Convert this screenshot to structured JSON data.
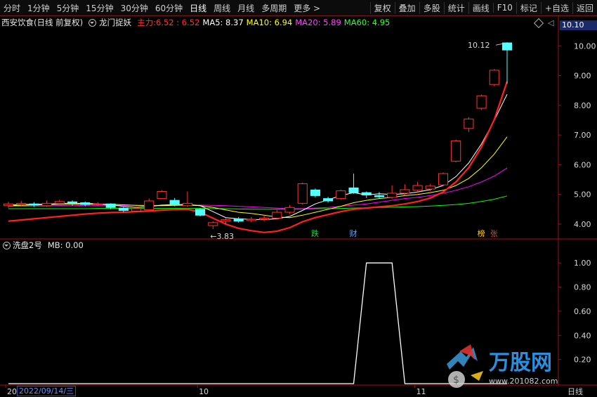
{
  "toolbar": {
    "left_items": [
      "分时",
      "1分钟",
      "5分钟",
      "15分钟",
      "30分钟",
      "60分钟",
      "日线",
      "周线",
      "月线",
      "多周期",
      "更多 >"
    ],
    "active": "日线",
    "right_items": [
      "复权",
      "叠加",
      "多股",
      "统计",
      "画线",
      "F10",
      "标记",
      "+自选",
      "返回"
    ]
  },
  "info": {
    "stock": "西安饮食(日线 前复权)",
    "indicator": "龙门捉妖",
    "main_label": "主力:",
    "main_value": "6.52 : 6.52",
    "ma5": "MA5: 8.37",
    "ma10": "MA10: 6.94",
    "ma20": "MA20: 5.89",
    "ma60": "MA60: 4.95",
    "current_price": "10.10"
  },
  "indicator_panel": {
    "name": "洗盘2号",
    "value": "MB: 0.00"
  },
  "colors": {
    "up": "#ff3232",
    "down": "#54ffff",
    "ma5": "#ffffff",
    "ma10": "#ffff00",
    "ma20": "#ff00ff",
    "ma60": "#00ff00",
    "main": "#ff2020",
    "axis": "#a01010"
  },
  "chart_data": [
    {
      "type": "candlestick",
      "yaxis_ticks": [
        "10.00",
        "9.00",
        "8.00",
        "7.00",
        "6.00",
        "5.00",
        "4.00"
      ],
      "ylim": [
        3.55,
        10.55
      ],
      "annotations": {
        "high_label": "10.12",
        "low_label": "←3.83",
        "low_value": 3.83
      },
      "markers": [
        {
          "text": "跌",
          "color": "#22cc44",
          "index": 24
        },
        {
          "text": "财",
          "color": "#5fa8ff",
          "index": 27
        },
        {
          "text": "榜",
          "color": "#ffcc00",
          "index": 37
        },
        {
          "text": "张",
          "color": "#ff3333",
          "index": 38
        }
      ],
      "x_tick_labels": [
        {
          "text": "20",
          "index": 0
        },
        {
          "text": "10",
          "index": 15
        },
        {
          "text": "11",
          "index": 32
        }
      ],
      "x_selected_date": "2022/09/14/三",
      "candles": [
        {
          "o": 4.62,
          "c": 4.68,
          "h": 4.75,
          "l": 4.55
        },
        {
          "o": 4.66,
          "c": 4.7,
          "h": 4.78,
          "l": 4.6
        },
        {
          "o": 4.68,
          "c": 4.64,
          "h": 4.74,
          "l": 4.58
        },
        {
          "o": 4.62,
          "c": 4.7,
          "h": 4.8,
          "l": 4.58
        },
        {
          "o": 4.7,
          "c": 4.76,
          "h": 4.82,
          "l": 4.64
        },
        {
          "o": 4.75,
          "c": 4.7,
          "h": 4.8,
          "l": 4.62
        },
        {
          "o": 4.72,
          "c": 4.66,
          "h": 4.76,
          "l": 4.6
        },
        {
          "o": 4.66,
          "c": 4.68,
          "h": 4.74,
          "l": 4.6
        },
        {
          "o": 4.68,
          "c": 4.56,
          "h": 4.7,
          "l": 4.5
        },
        {
          "o": 4.54,
          "c": 4.46,
          "h": 4.58,
          "l": 4.4
        },
        {
          "o": 4.44,
          "c": 4.52,
          "h": 4.6,
          "l": 4.4
        },
        {
          "o": 4.48,
          "c": 4.78,
          "h": 4.86,
          "l": 4.44
        },
        {
          "o": 4.86,
          "c": 5.1,
          "h": 5.14,
          "l": 4.84
        },
        {
          "o": 4.8,
          "c": 4.66,
          "h": 4.88,
          "l": 4.6
        },
        {
          "o": 4.62,
          "c": 4.7,
          "h": 5.1,
          "l": 4.58
        },
        {
          "o": 4.5,
          "c": 4.3,
          "h": 4.54,
          "l": 4.26
        },
        {
          "o": 3.95,
          "c": 4.05,
          "h": 4.1,
          "l": 3.83
        },
        {
          "o": 4.1,
          "c": 4.15,
          "h": 4.2,
          "l": 4.0
        },
        {
          "o": 4.18,
          "c": 4.1,
          "h": 4.24,
          "l": 4.05
        },
        {
          "o": 4.12,
          "c": 4.16,
          "h": 4.24,
          "l": 4.06
        },
        {
          "o": 4.16,
          "c": 4.2,
          "h": 4.3,
          "l": 4.1
        },
        {
          "o": 4.2,
          "c": 4.4,
          "h": 4.48,
          "l": 4.16
        },
        {
          "o": 4.4,
          "c": 4.56,
          "h": 4.64,
          "l": 4.34
        },
        {
          "o": 4.7,
          "c": 5.36,
          "h": 5.4,
          "l": 4.66
        },
        {
          "o": 5.15,
          "c": 4.96,
          "h": 5.2,
          "l": 4.9
        },
        {
          "o": 4.86,
          "c": 4.78,
          "h": 4.92,
          "l": 4.72
        },
        {
          "o": 4.86,
          "c": 5.12,
          "h": 5.16,
          "l": 4.82
        },
        {
          "o": 5.22,
          "c": 5.06,
          "h": 5.7,
          "l": 5.02
        },
        {
          "o": 5.06,
          "c": 4.98,
          "h": 5.1,
          "l": 4.88
        },
        {
          "o": 4.96,
          "c": 4.92,
          "h": 5.08,
          "l": 4.86
        },
        {
          "o": 4.9,
          "c": 5.04,
          "h": 5.3,
          "l": 4.86
        },
        {
          "o": 5.04,
          "c": 5.16,
          "h": 5.34,
          "l": 4.96
        },
        {
          "o": 5.14,
          "c": 5.3,
          "h": 5.42,
          "l": 5.08
        },
        {
          "o": 5.18,
          "c": 5.28,
          "h": 5.36,
          "l": 5.1
        },
        {
          "o": 5.32,
          "c": 5.7,
          "h": 5.74,
          "l": 5.28
        },
        {
          "o": 6.12,
          "c": 6.8,
          "h": 6.84,
          "l": 6.08
        },
        {
          "o": 7.22,
          "c": 7.54,
          "h": 7.6,
          "l": 7.1
        },
        {
          "o": 7.9,
          "c": 8.32,
          "h": 8.36,
          "l": 7.84
        },
        {
          "o": 8.7,
          "c": 9.18,
          "h": 9.22,
          "l": 8.64
        },
        {
          "o": 10.1,
          "c": 9.86,
          "h": 10.12,
          "l": 8.72
        }
      ],
      "lines": {
        "ma5": [
          4.64,
          4.66,
          4.67,
          4.67,
          4.7,
          4.7,
          4.7,
          4.68,
          4.65,
          4.6,
          4.56,
          4.59,
          4.64,
          4.66,
          4.66,
          4.62,
          4.42,
          4.22,
          4.18,
          4.16,
          4.15,
          4.18,
          4.26,
          4.46,
          4.68,
          4.82,
          4.96,
          5.06,
          4.98,
          5.02,
          5.0,
          5.02,
          5.08,
          5.16,
          5.3,
          5.6,
          6.06,
          6.7,
          7.5,
          8.37
        ],
        "ma10": [
          4.62,
          4.63,
          4.64,
          4.65,
          4.66,
          4.67,
          4.67,
          4.67,
          4.67,
          4.65,
          4.63,
          4.62,
          4.62,
          4.63,
          4.64,
          4.62,
          4.56,
          4.48,
          4.4,
          4.36,
          4.3,
          4.24,
          4.22,
          4.3,
          4.4,
          4.5,
          4.6,
          4.72,
          4.8,
          4.86,
          4.9,
          4.96,
          5.0,
          5.06,
          5.14,
          5.3,
          5.54,
          5.9,
          6.36,
          6.94
        ],
        "ma20": [
          4.6,
          4.6,
          4.61,
          4.61,
          4.62,
          4.62,
          4.63,
          4.63,
          4.63,
          4.63,
          4.63,
          4.63,
          4.63,
          4.63,
          4.64,
          4.64,
          4.63,
          4.62,
          4.6,
          4.58,
          4.56,
          4.54,
          4.52,
          4.52,
          4.54,
          4.56,
          4.6,
          4.64,
          4.68,
          4.74,
          4.8,
          4.86,
          4.9,
          4.96,
          5.04,
          5.14,
          5.26,
          5.42,
          5.62,
          5.89
        ],
        "ma60": [
          4.52,
          4.52,
          4.52,
          4.52,
          4.52,
          4.52,
          4.52,
          4.53,
          4.53,
          4.53,
          4.53,
          4.53,
          4.53,
          4.53,
          4.53,
          4.53,
          4.52,
          4.52,
          4.51,
          4.5,
          4.5,
          4.5,
          4.5,
          4.51,
          4.52,
          4.52,
          4.53,
          4.54,
          4.55,
          4.56,
          4.57,
          4.58,
          4.59,
          4.61,
          4.63,
          4.66,
          4.7,
          4.76,
          4.84,
          4.95
        ],
        "main": [
          4.1,
          4.14,
          4.18,
          4.22,
          4.26,
          4.3,
          4.34,
          4.37,
          4.39,
          4.4,
          4.42,
          4.44,
          4.47,
          4.49,
          4.5,
          4.4,
          4.2,
          4.0,
          3.86,
          3.78,
          3.72,
          3.76,
          3.88,
          4.08,
          4.22,
          4.32,
          4.42,
          4.5,
          4.54,
          4.58,
          4.62,
          4.68,
          4.76,
          4.88,
          5.08,
          5.42,
          5.9,
          6.6,
          7.52,
          8.8
        ]
      }
    },
    {
      "type": "line",
      "yaxis_ticks": [
        "1.00",
        "0.80",
        "0.60",
        "0.40",
        "0.20"
      ],
      "ylim": [
        0,
        1.1
      ],
      "values": [
        0,
        0,
        0,
        0,
        0,
        0,
        0,
        0,
        0,
        0,
        0,
        0,
        0,
        0,
        0,
        0,
        0,
        0,
        0,
        0,
        0,
        0,
        0,
        0,
        0,
        0,
        0,
        0,
        1,
        1,
        1,
        0,
        0,
        0,
        0,
        0,
        0,
        0,
        0,
        0
      ]
    }
  ],
  "watermark": {
    "text": "万股网",
    "url": "www.201082.com"
  },
  "bottom": {
    "period_label": "日线"
  }
}
